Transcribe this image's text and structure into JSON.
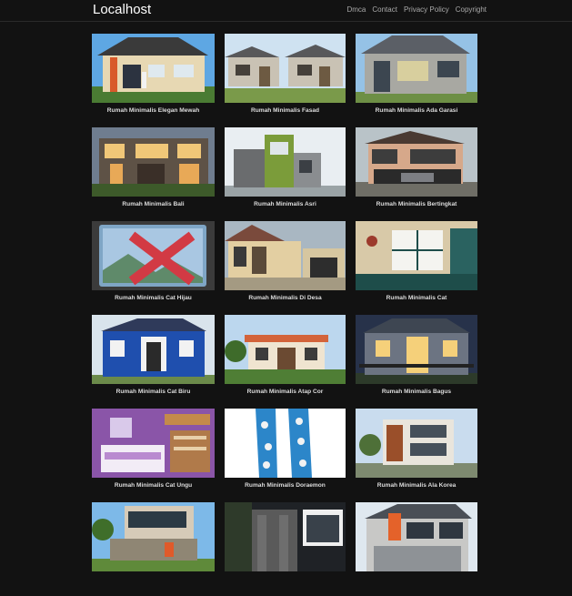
{
  "site": {
    "title": "Localhost"
  },
  "nav": [
    {
      "label": "Dmca"
    },
    {
      "label": "Contact"
    },
    {
      "label": "Privacy Policy"
    },
    {
      "label": "Copyright"
    }
  ],
  "posts": [
    {
      "title": "Rumah Minimalis Elegan Mewah",
      "thumb": "orange-front-house"
    },
    {
      "title": "Rumah Minimalis Fasad",
      "thumb": "grey-twin-houses"
    },
    {
      "title": "Rumah Minimalis Ada Garasi",
      "thumb": "grey-modern-house"
    },
    {
      "title": "Rumah Minimalis Bali",
      "thumb": "night-lit-house"
    },
    {
      "title": "Rumah Minimalis Asri",
      "thumb": "green-accent-house"
    },
    {
      "title": "Rumah Minimalis Bertingkat",
      "thumb": "two-storey-house"
    },
    {
      "title": "Rumah Minimalis Cat Hijau",
      "thumb": "broken-image"
    },
    {
      "title": "Rumah Minimalis Di Desa",
      "thumb": "village-house"
    },
    {
      "title": "Rumah Minimalis Cat",
      "thumb": "painted-interior"
    },
    {
      "title": "Rumah Minimalis Cat Biru",
      "thumb": "blue-house"
    },
    {
      "title": "Rumah Minimalis Atap Cor",
      "thumb": "flat-roof-house"
    },
    {
      "title": "Rumah Minimalis Bagus",
      "thumb": "dusk-house"
    },
    {
      "title": "Rumah Minimalis Cat Ungu",
      "thumb": "purple-bedroom"
    },
    {
      "title": "Rumah Minimalis Doraemon",
      "thumb": "doraemon-curtains"
    },
    {
      "title": "Rumah Minimalis Ala Korea",
      "thumb": "wood-facade-house"
    },
    {
      "title": "",
      "thumb": "modern-box-house"
    },
    {
      "title": "",
      "thumb": "stone-column-house"
    },
    {
      "title": "",
      "thumb": "orange-trim-house"
    }
  ]
}
